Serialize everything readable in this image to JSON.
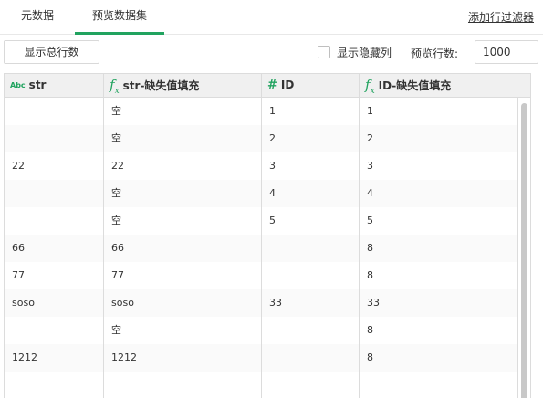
{
  "tabs": [
    {
      "label": "元数据",
      "active": false
    },
    {
      "label": "预览数据集",
      "active": true
    }
  ],
  "filter_link": "添加行过滤器",
  "toolbar": {
    "show_total_label": "显示总行数",
    "show_hidden_label": "显示隐藏列",
    "preview_rows_label": "预览行数:",
    "preview_rows_value": "1000"
  },
  "accent_color": "#21a35f",
  "columns": [
    {
      "name": "str",
      "type_icon": "Abc"
    },
    {
      "name": "str-缺失值填充",
      "type_icon": "fx"
    },
    {
      "name": "ID",
      "type_icon": "#"
    },
    {
      "name": "ID-缺失值填充",
      "type_icon": "fx"
    }
  ],
  "rows": [
    [
      "",
      "空",
      "1",
      "1"
    ],
    [
      "",
      "空",
      "2",
      "2"
    ],
    [
      "22",
      "22",
      "3",
      "3"
    ],
    [
      "",
      "空",
      "4",
      "4"
    ],
    [
      "",
      "空",
      "5",
      "5"
    ],
    [
      "66",
      "66",
      "",
      "8"
    ],
    [
      "77",
      "77",
      "",
      "8"
    ],
    [
      "soso",
      "soso",
      "33",
      "33"
    ],
    [
      "",
      "空",
      "",
      "8"
    ],
    [
      "1212",
      "1212",
      "",
      "8"
    ],
    [
      "",
      "",
      "",
      ""
    ]
  ]
}
